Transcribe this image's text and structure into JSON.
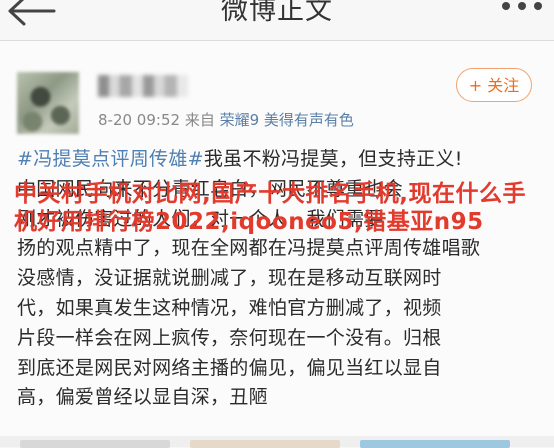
{
  "nav": {
    "title": "微博正文",
    "back_icon": "arrow-left-icon",
    "more_icon": "more-dots-icon"
  },
  "post": {
    "time": "8-20 09:52",
    "from_label": "来自",
    "device": "荣耀9 美得有声有色",
    "follow_label": "+ 关注",
    "accent_color": "#f06c19",
    "link_color": "#4f7fb3",
    "lines": [
      {
        "tag": "#冯提莫点评周传雄#",
        "text": "我虽不粉冯提莫，但支持正义!"
      },
      {
        "tag": "",
        "text": "中国网民向来不分青红皂白，网民不尊重也会"
      },
      {
        "tag": "",
        "text": "刚才被伤害过的人们，对一个人，我们需要"
      },
      {
        "tag": "",
        "text": "扬的观点精中了，现在全网都在冯提莫点评周传雄唱歌"
      },
      {
        "tag": "",
        "text": "没感情，没证据就说删减了，现在是移动互联网时"
      },
      {
        "tag": "",
        "text": "代，如果真发生这种情况，难怕官方删减了，视频"
      },
      {
        "tag": "",
        "text": "片段一样会在网上疯传，奈何现在一个没有。归根"
      },
      {
        "tag": "",
        "text": "到底还是网民对网络主播的偏见，偏见当红以显自"
      },
      {
        "tag": "",
        "text": "高，偏爱曾经以显自深，丑陋"
      }
    ]
  },
  "overlay_text": "中关村手机对比网,国产十大排名手机,现在什么手机好用排行榜2022,iqooneo5,错基亚n95",
  "overlay_color": "#e23a2c"
}
